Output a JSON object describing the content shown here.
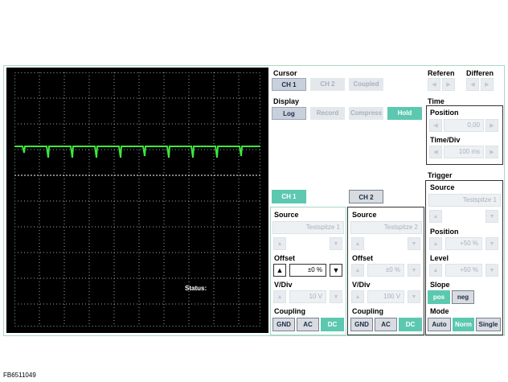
{
  "scope": {
    "status_label": "Status:"
  },
  "cursor": {
    "title": "Cursor",
    "buttons": [
      "CH 1",
      "CH 2",
      "Coupled"
    ]
  },
  "display": {
    "title": "Display",
    "buttons": [
      "Log",
      "Record",
      "Compress",
      "Hold"
    ]
  },
  "reference": {
    "title": "Referen"
  },
  "difference": {
    "title": "Differen"
  },
  "time": {
    "title": "Time",
    "position_label": "Position",
    "position_value": "0,00",
    "timediv_label": "Time/Div",
    "timediv_value": "100 ms"
  },
  "ch1": {
    "tab": "CH 1",
    "source_label": "Source",
    "source_value": "Testspitze 1",
    "offset_label": "Offset",
    "offset_value": "±0 %",
    "vdiv_label": "V/Div",
    "vdiv_value": "10 V",
    "coupling_label": "Coupling",
    "coupling": [
      "GND",
      "AC",
      "DC"
    ]
  },
  "ch2": {
    "tab": "CH 2",
    "source_label": "Source",
    "source_value": "Testspitze 2",
    "offset_label": "Offset",
    "offset_value": "±0 %",
    "vdiv_label": "V/Div",
    "vdiv_value": "100 V",
    "coupling_label": "Coupling",
    "coupling": [
      "GND",
      "AC",
      "DC"
    ]
  },
  "trigger": {
    "title": "Trigger",
    "source_label": "Source",
    "source_value": "Testspitze 1",
    "position_label": "Position",
    "position_value": "+50 %",
    "level_label": "Level",
    "level_value": "+50 %",
    "slope_label": "Slope",
    "slope": [
      "pos",
      "neg"
    ],
    "mode_label": "Mode",
    "mode": [
      "Auto",
      "Norm",
      "Single"
    ]
  },
  "colors": {
    "trace": "#3ee63e",
    "accent": "#5cc8b0",
    "frame": "#a8d8c8"
  },
  "caption": "FB6511049"
}
